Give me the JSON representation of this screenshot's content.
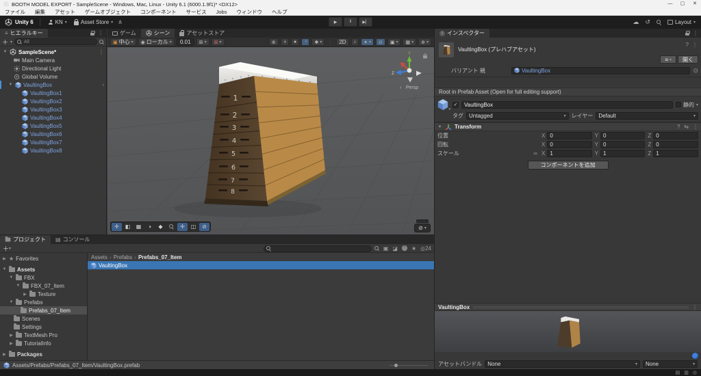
{
  "window": {
    "title": "BOOTH MODEL EXPORT - SampleScene - Windows, Mac, Linux - Unity 6.1 (6000.1.9f1)* <DX12>"
  },
  "menu": {
    "items": [
      "ファイル",
      "編集",
      "アセット",
      "ゲームオブジェクト",
      "コンポーネント",
      "サービス",
      "Jobs",
      "ウィンドウ",
      "ヘルプ"
    ]
  },
  "toolbar": {
    "brand": "Unity 6",
    "account": "KN",
    "store": "Asset Store",
    "layout": "Layout"
  },
  "hierarchy": {
    "tab": "ヒエラルキー",
    "search": "All",
    "scene_row": "SampleScene*",
    "objects": [
      "Main Camera",
      "Directional Light",
      "Global Volume"
    ],
    "prefab_root": "VaultingBox",
    "children": [
      "VaultingBox1",
      "VaultingBox2",
      "VaultingBox3",
      "VaultingBox4",
      "VaultingBox5",
      "VaultingBox6",
      "VaultingBox7",
      "VaultingBox8"
    ]
  },
  "scene": {
    "tab_game": "ゲーム",
    "tab_scene": "シーン",
    "tab_store": "アセットストア",
    "pivot": "中心",
    "space": "ローカル",
    "grid_size": "0.01",
    "mode_2d": "2D",
    "persp": "Persp",
    "axis_y": "Y",
    "axis_z": "Z",
    "numbers": [
      "1",
      "2",
      "3",
      "4",
      "5",
      "6",
      "7",
      "8"
    ]
  },
  "inspector": {
    "tab": "インスペクター",
    "header": {
      "title": "VaultingBox (プレハブアセット)",
      "open": "開く"
    },
    "variant": {
      "label": "バリアント 親",
      "value": "VaultingBox"
    },
    "root_note": "Root in Prefab Asset (Open for full editing support)",
    "gameobject": {
      "name": "VaultingBox",
      "static_label": "静的",
      "tag_label": "タグ",
      "tag": "Untagged",
      "layer_label": "レイヤー",
      "layer": "Default"
    },
    "transform": {
      "title": "Transform",
      "axis": {
        "x": "X",
        "y": "Y",
        "z": "Z"
      },
      "rows": [
        {
          "label": "位置",
          "x": "0",
          "y": "0",
          "z": "0"
        },
        {
          "label": "回転",
          "x": "0",
          "y": "0",
          "z": "0"
        },
        {
          "label": "スケール",
          "x": "1",
          "y": "1",
          "z": "1"
        }
      ]
    },
    "add_component": "コンポーネントを追加",
    "preview": {
      "title": "VaultingBox",
      "assetbundle_label": "アセットバンドル",
      "bundle": "None",
      "variant_bundle": "None"
    }
  },
  "project": {
    "tab_project": "プロジェクト",
    "tab_console": "コンソール",
    "tree": [
      {
        "label": "Favorites"
      },
      {
        "label": "Assets"
      },
      {
        "label": "FBX"
      },
      {
        "label": "FBX_07_Item"
      },
      {
        "label": "Texture"
      },
      {
        "label": "Prefabs"
      },
      {
        "label": "Prefabs_07_Item"
      },
      {
        "label": "Scenes"
      },
      {
        "label": "Settings"
      },
      {
        "label": "TextMesh Pro"
      },
      {
        "label": "TutorialInfo"
      },
      {
        "label": "Packages"
      }
    ],
    "breadcrumb": [
      "Assets",
      "Prefabs",
      "Prefabs_07_Item"
    ],
    "selected_item": "VaultingBox",
    "eye_count": "24",
    "footer_path": "Assets/Prefabs/Prefabs_07_Item/VaultingBox.prefab"
  }
}
